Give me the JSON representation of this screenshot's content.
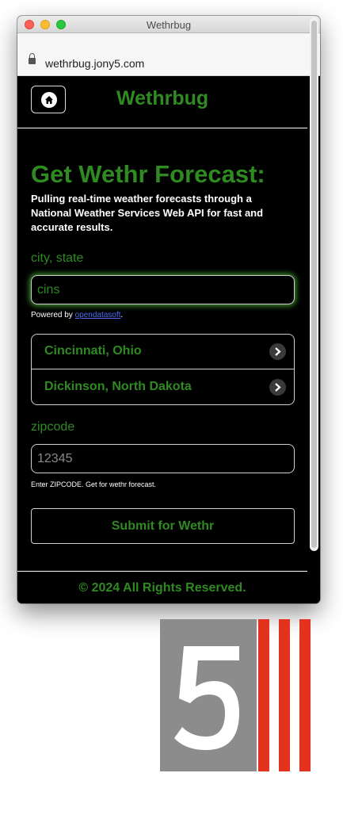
{
  "window": {
    "title": "Wethrbug"
  },
  "browser": {
    "url": "wethrbug.jony5.com"
  },
  "header": {
    "brand": "Wethrbug",
    "home_icon": "home-icon"
  },
  "hero": {
    "title": "Get Wethr Forecast:",
    "description": "Pulling real-time weather forecasts through a National Weather Services Web API for fast and accurate results."
  },
  "city": {
    "label": "city, state",
    "value": "cins",
    "powered_prefix": "Powered by ",
    "powered_link": "opendatasoft",
    "powered_suffix": "."
  },
  "suggestions": [
    {
      "label": "Cincinnati, Ohio"
    },
    {
      "label": "Dickinson, North Dakota"
    }
  ],
  "zip": {
    "label": "zipcode",
    "placeholder": "12345",
    "help": "Enter ZIPCODE. Get for wethr forecast."
  },
  "submit": {
    "label": "Submit for Wethr"
  },
  "footer": {
    "text": "© 2024 All Rights Reserved."
  },
  "colors": {
    "accent": "#2f8a22",
    "background": "#000000",
    "logo_gray": "#8c8c8c",
    "logo_red": "#e3331f"
  }
}
